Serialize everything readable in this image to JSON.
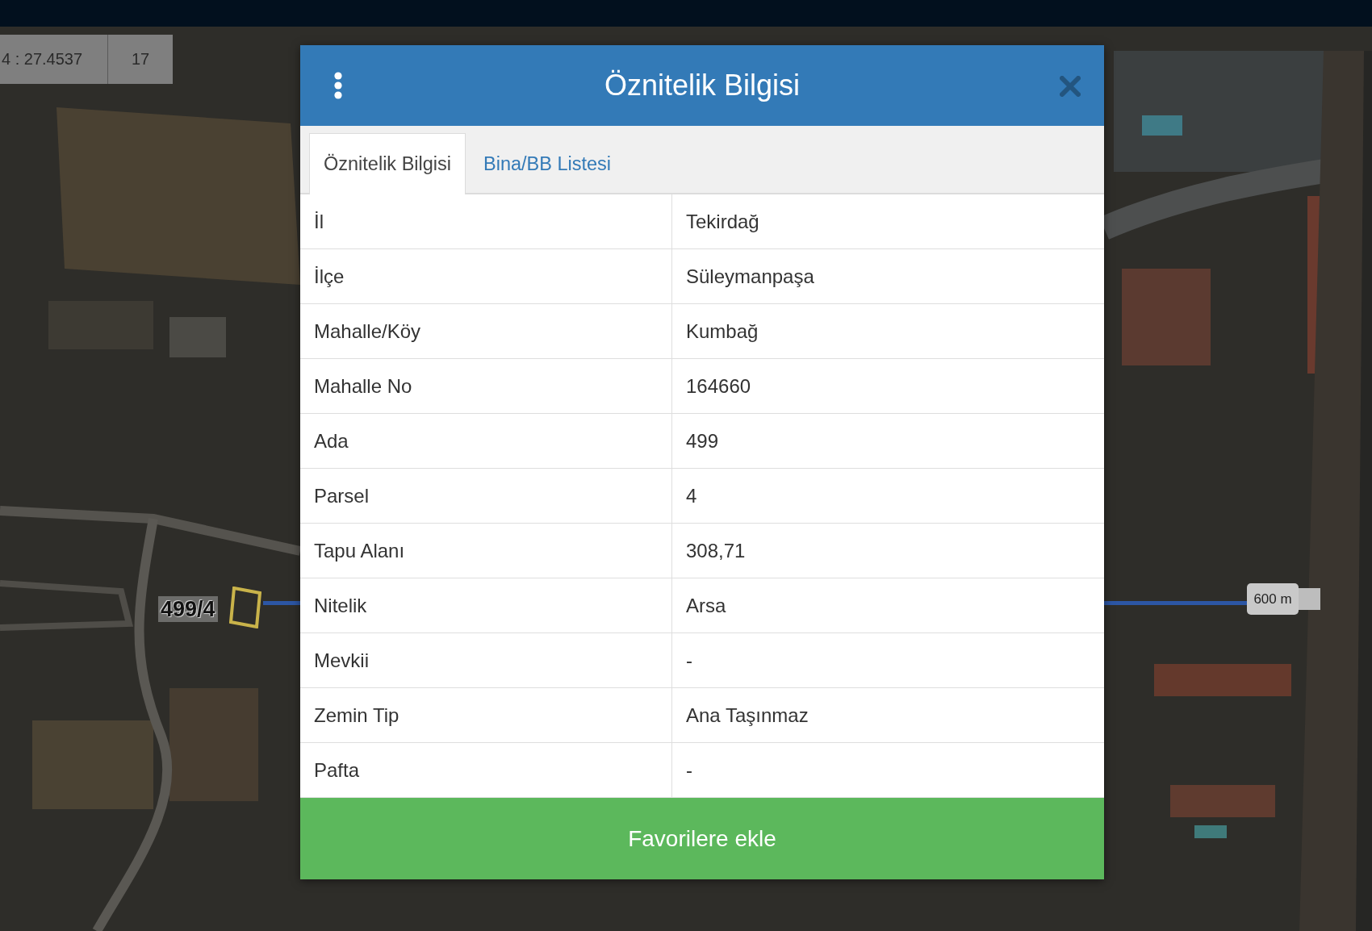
{
  "coordinates": {
    "position": "4 : 27.4537",
    "zoom": "17"
  },
  "map": {
    "parcel_label": "499/4",
    "measurement": "600 m"
  },
  "dialog": {
    "title": "Öznitelik Bilgisi",
    "tabs": [
      {
        "label": "Öznitelik Bilgisi",
        "selected": true
      },
      {
        "label": "Bina/BB Listesi",
        "selected": false
      }
    ],
    "rows": [
      {
        "label": "İl",
        "value": "Tekirdağ"
      },
      {
        "label": "İlçe",
        "value": "Süleymanpaşa"
      },
      {
        "label": "Mahalle/Köy",
        "value": "Kumbağ"
      },
      {
        "label": "Mahalle No",
        "value": "164660"
      },
      {
        "label": "Ada",
        "value": "499"
      },
      {
        "label": "Parsel",
        "value": "4"
      },
      {
        "label": "Tapu Alanı",
        "value": "308,71"
      },
      {
        "label": "Nitelik",
        "value": "Arsa"
      },
      {
        "label": "Mevkii",
        "value": "-"
      },
      {
        "label": "Zemin Tip",
        "value": "Ana Taşınmaz"
      },
      {
        "label": "Pafta",
        "value": "-"
      }
    ],
    "action": "Favorilere ekle"
  }
}
